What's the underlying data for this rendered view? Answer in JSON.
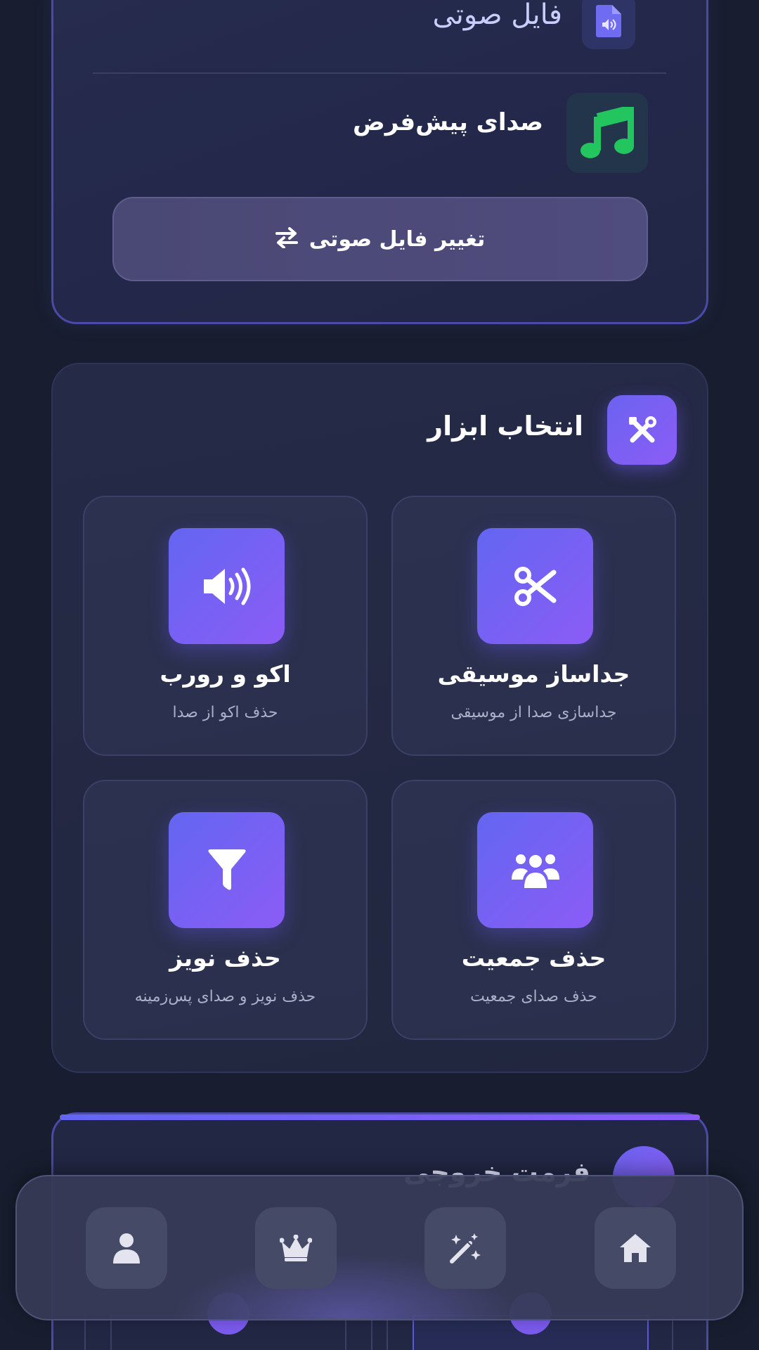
{
  "audio_card": {
    "file_label": "فایل صوتی",
    "default_sound_label": "صدای پیش‌فرض",
    "change_button_label": "تغییر فایل صوتی"
  },
  "tools_card": {
    "title": "انتخاب ابزار",
    "tools": [
      {
        "name": "جداساز موسیقی",
        "desc": "جداسازی صدا از موسیقی",
        "icon": "scissors-icon"
      },
      {
        "name": "اکو و رورب",
        "desc": "حذف اکو از صدا",
        "icon": "speaker-icon"
      },
      {
        "name": "حذف جمعیت",
        "desc": "حذف صدای جمعیت",
        "icon": "users-icon"
      },
      {
        "name": "حذف نویز",
        "desc": "حذف نویز و صدای پس‌زمینه",
        "icon": "filter-icon"
      }
    ]
  },
  "output_card": {
    "title": "فرمت خروجی"
  },
  "bottom_nav": {
    "items": [
      "home-icon",
      "magic-wand-icon",
      "crown-icon",
      "user-icon"
    ]
  },
  "colors": {
    "background": "#181e2f",
    "accent_start": "#6366f1",
    "accent_end": "#8b5cf6",
    "music_green": "#22c55e"
  }
}
